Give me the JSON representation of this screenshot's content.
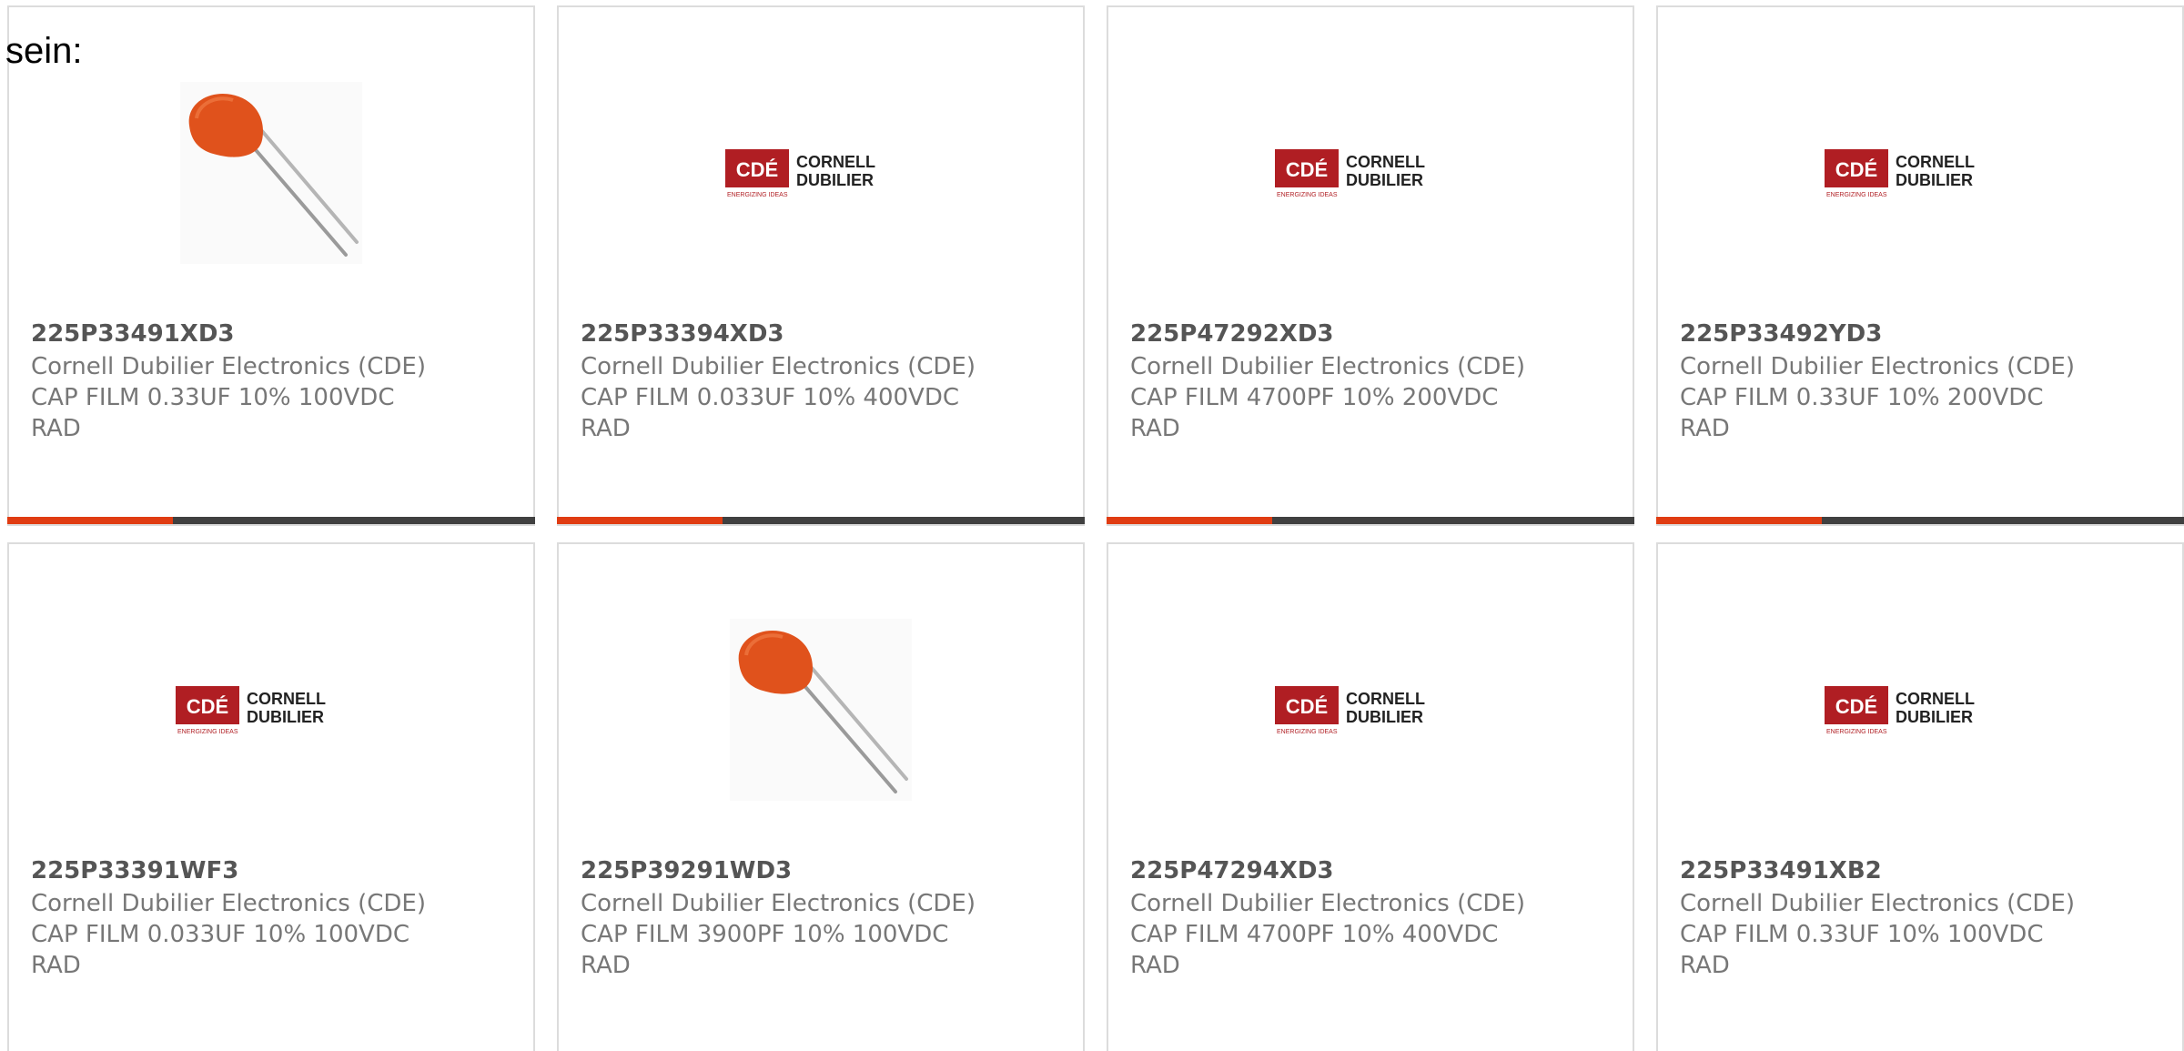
{
  "intro": "sein:",
  "colors": {
    "accent_bar": "#e03c12",
    "dark_bar": "#404040",
    "card_border": "#dcdcdc",
    "cde_logo_red": "#b01e23",
    "capacitor_orange": "#e0521c"
  },
  "products": [
    {
      "part": "225P33491XD3",
      "manufacturer": "Cornell Dubilier Electronics (CDE)",
      "desc1": "CAP FILM 0.33UF 10% 100VDC",
      "desc2": "RAD",
      "image": "capacitor-photo"
    },
    {
      "part": "225P33394XD3",
      "manufacturer": "Cornell Dubilier Electronics (CDE)",
      "desc1": "CAP FILM 0.033UF 10% 400VDC",
      "desc2": "RAD",
      "image": "cde-logo"
    },
    {
      "part": "225P47292XD3",
      "manufacturer": "Cornell Dubilier Electronics (CDE)",
      "desc1": "CAP FILM 4700PF 10% 200VDC",
      "desc2": "RAD",
      "image": "cde-logo"
    },
    {
      "part": "225P33492YD3",
      "manufacturer": "Cornell Dubilier Electronics (CDE)",
      "desc1": "CAP FILM 0.33UF 10% 200VDC",
      "desc2": "RAD",
      "image": "cde-logo"
    },
    {
      "part": "225P33391WF3",
      "manufacturer": "Cornell Dubilier Electronics (CDE)",
      "desc1": "CAP FILM 0.033UF 10% 100VDC",
      "desc2": "RAD",
      "image": "cde-logo"
    },
    {
      "part": "225P39291WD3",
      "manufacturer": "Cornell Dubilier Electronics (CDE)",
      "desc1": "CAP FILM 3900PF 10% 100VDC",
      "desc2": "RAD",
      "image": "capacitor-photo"
    },
    {
      "part": "225P47294XD3",
      "manufacturer": "Cornell Dubilier Electronics (CDE)",
      "desc1": "CAP FILM 4700PF 10% 400VDC",
      "desc2": "RAD",
      "image": "cde-logo"
    },
    {
      "part": "225P33491XB2",
      "manufacturer": "Cornell Dubilier Electronics (CDE)",
      "desc1": "CAP FILM 0.33UF 10% 100VDC",
      "desc2": "RAD",
      "image": "cde-logo"
    }
  ],
  "cde_logo": {
    "mark": "CDÉ",
    "line1": "CORNELL",
    "line2": "DUBILIER",
    "tagline": "ENERGIZING IDEAS"
  }
}
